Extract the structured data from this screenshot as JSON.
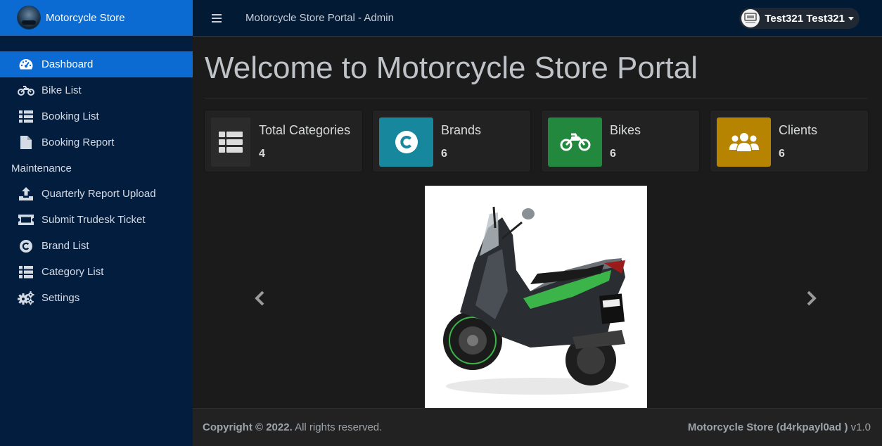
{
  "sidebar": {
    "brand_name": "Motorcycle Store",
    "items": [
      {
        "label": "Dashboard",
        "icon": "tachometer-icon",
        "active": true
      },
      {
        "label": "Bike List",
        "icon": "motorcycle-icon"
      },
      {
        "label": "Booking List",
        "icon": "list-icon"
      },
      {
        "label": "Booking Report",
        "icon": "file-icon"
      }
    ],
    "section_header": "Maintenance",
    "maintenance_items": [
      {
        "label": "Quarterly Report Upload",
        "icon": "upload-icon"
      },
      {
        "label": "Submit Trudesk Ticket",
        "icon": "ticket-icon"
      },
      {
        "label": "Brand List",
        "icon": "copyright-icon"
      },
      {
        "label": "Category List",
        "icon": "list-icon"
      },
      {
        "label": "Settings",
        "icon": "cogs-icon"
      }
    ]
  },
  "header": {
    "portal_title": "Motorcycle Store Portal - Admin",
    "user_name": "Test321 Test321"
  },
  "main": {
    "page_title": "Welcome to Motorcycle Store Portal",
    "stats": [
      {
        "label": "Total Categories",
        "value": "4",
        "icon": "th-list-icon",
        "color": "#2b2b2b"
      },
      {
        "label": "Brands",
        "value": "6",
        "icon": "copyright-icon",
        "color": "#17879e"
      },
      {
        "label": "Bikes",
        "value": "6",
        "icon": "motorcycle-icon",
        "color": "#22883d"
      },
      {
        "label": "Clients",
        "value": "6",
        "icon": "users-icon",
        "color": "#b68400"
      }
    ]
  },
  "footer": {
    "copyright": "Copyright © 2022.",
    "rights": "All rights reserved.",
    "app_name": "Motorcycle Store (d4rkpayl0ad )",
    "version": "v1.0"
  }
}
